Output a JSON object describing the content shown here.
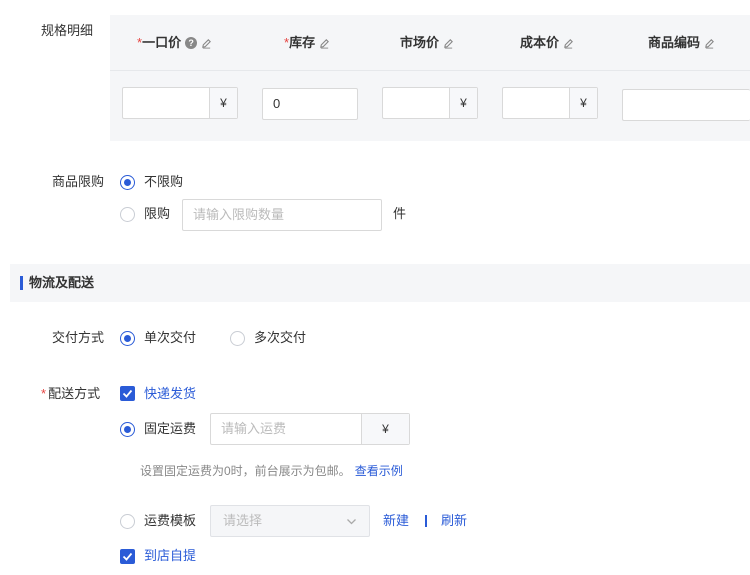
{
  "spec": {
    "label": "规格明细",
    "columns": [
      {
        "label": "一口价",
        "required": "*",
        "help": "?"
      },
      {
        "label": "库存",
        "required": "*"
      },
      {
        "label": "市场价"
      },
      {
        "label": "成本价"
      },
      {
        "label": "商品编码"
      }
    ],
    "row": {
      "price_value": "",
      "stock_value": "0",
      "market_value": "",
      "cost_value": "",
      "code_value": "",
      "currency": "¥"
    }
  },
  "limit": {
    "label": "商品限购",
    "option_unlimited": "不限购",
    "option_limited": "限购",
    "input_placeholder": "请输入限购数量",
    "unit": "件",
    "selected": "unlimited"
  },
  "logistics": {
    "section_title": "物流及配送",
    "delivery_mode": {
      "label": "交付方式",
      "option_single": "单次交付",
      "option_multi": "多次交付",
      "selected": "single"
    },
    "shipping": {
      "required": "*",
      "label": "配送方式",
      "express_label": "快递发货",
      "express_checked": true,
      "fixed_fee_label": "固定运费",
      "fixed_fee_placeholder": "请输入运费",
      "currency": "¥",
      "fixed_hint": "设置固定运费为0时，前台展示为包邮。",
      "view_example": "查看示例",
      "template_label": "运费模板",
      "template_placeholder": "请选择",
      "new_link": "新建",
      "refresh_link": "刷新",
      "pickup_label": "到店自提",
      "pickup_checked": true
    }
  },
  "colors": {
    "accent": "#2a5bd7",
    "required": "#e64340"
  },
  "icons": [
    "pencil-icon",
    "help-icon",
    "check-icon",
    "chevron-down-icon"
  ]
}
